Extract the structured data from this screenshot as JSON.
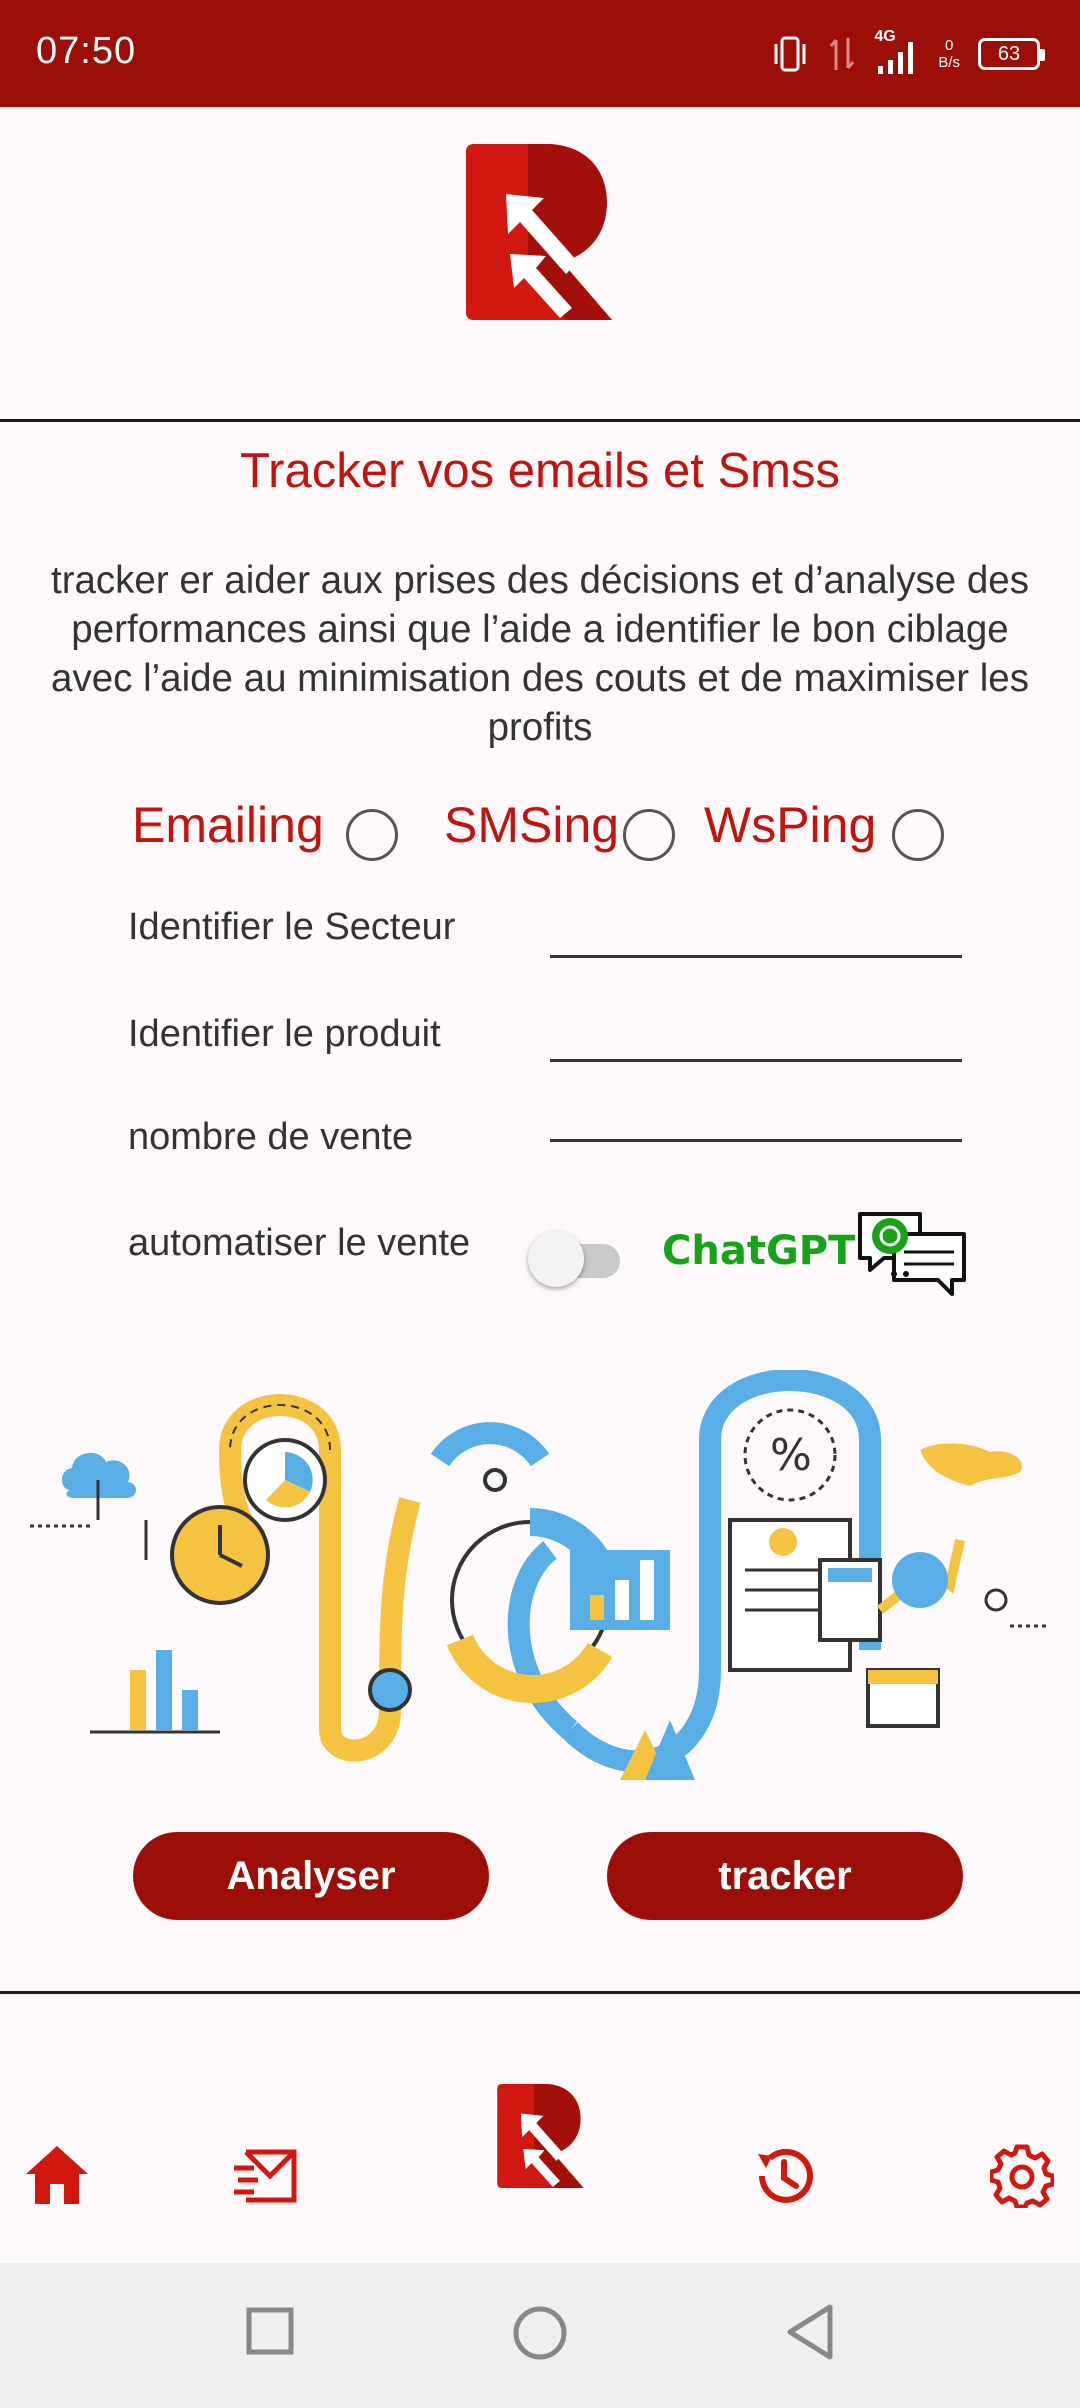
{
  "status": {
    "time": "07:50",
    "network": "4G",
    "speed_value": "0",
    "speed_unit": "B/s",
    "battery": "63"
  },
  "logo": {
    "name": "logo-icon"
  },
  "content": {
    "title": "Tracker vos emails et Smss",
    "description": "tracker er aider aux prises des décisions et d’analyse des performances ainsi que l’aide a identifier le bon ciblage avec l’aide au minimisation des couts et de maximiser les profits",
    "options": [
      "Emailing",
      "SMSing",
      "WsPing"
    ],
    "fields": {
      "secteur": "Identifier le Secteur",
      "produit": "Identifier le produit",
      "vente": "nombre de vente"
    },
    "automate_label": "automatiser le vente",
    "automate_on": false,
    "chatgpt": "ChatGPT"
  },
  "buttons": {
    "analyser": "Analyser",
    "tracker": "tracker"
  },
  "bottom_nav": [
    "home-icon",
    "mail-send-icon",
    "logo-icon",
    "history-icon",
    "gear-icon"
  ],
  "colors": {
    "brand": "#9b0f08",
    "accent_red": "#c0150e",
    "chatgpt_green": "#17a317",
    "illustration_blue": "#5aaee6",
    "illustration_yellow": "#f5c342"
  }
}
